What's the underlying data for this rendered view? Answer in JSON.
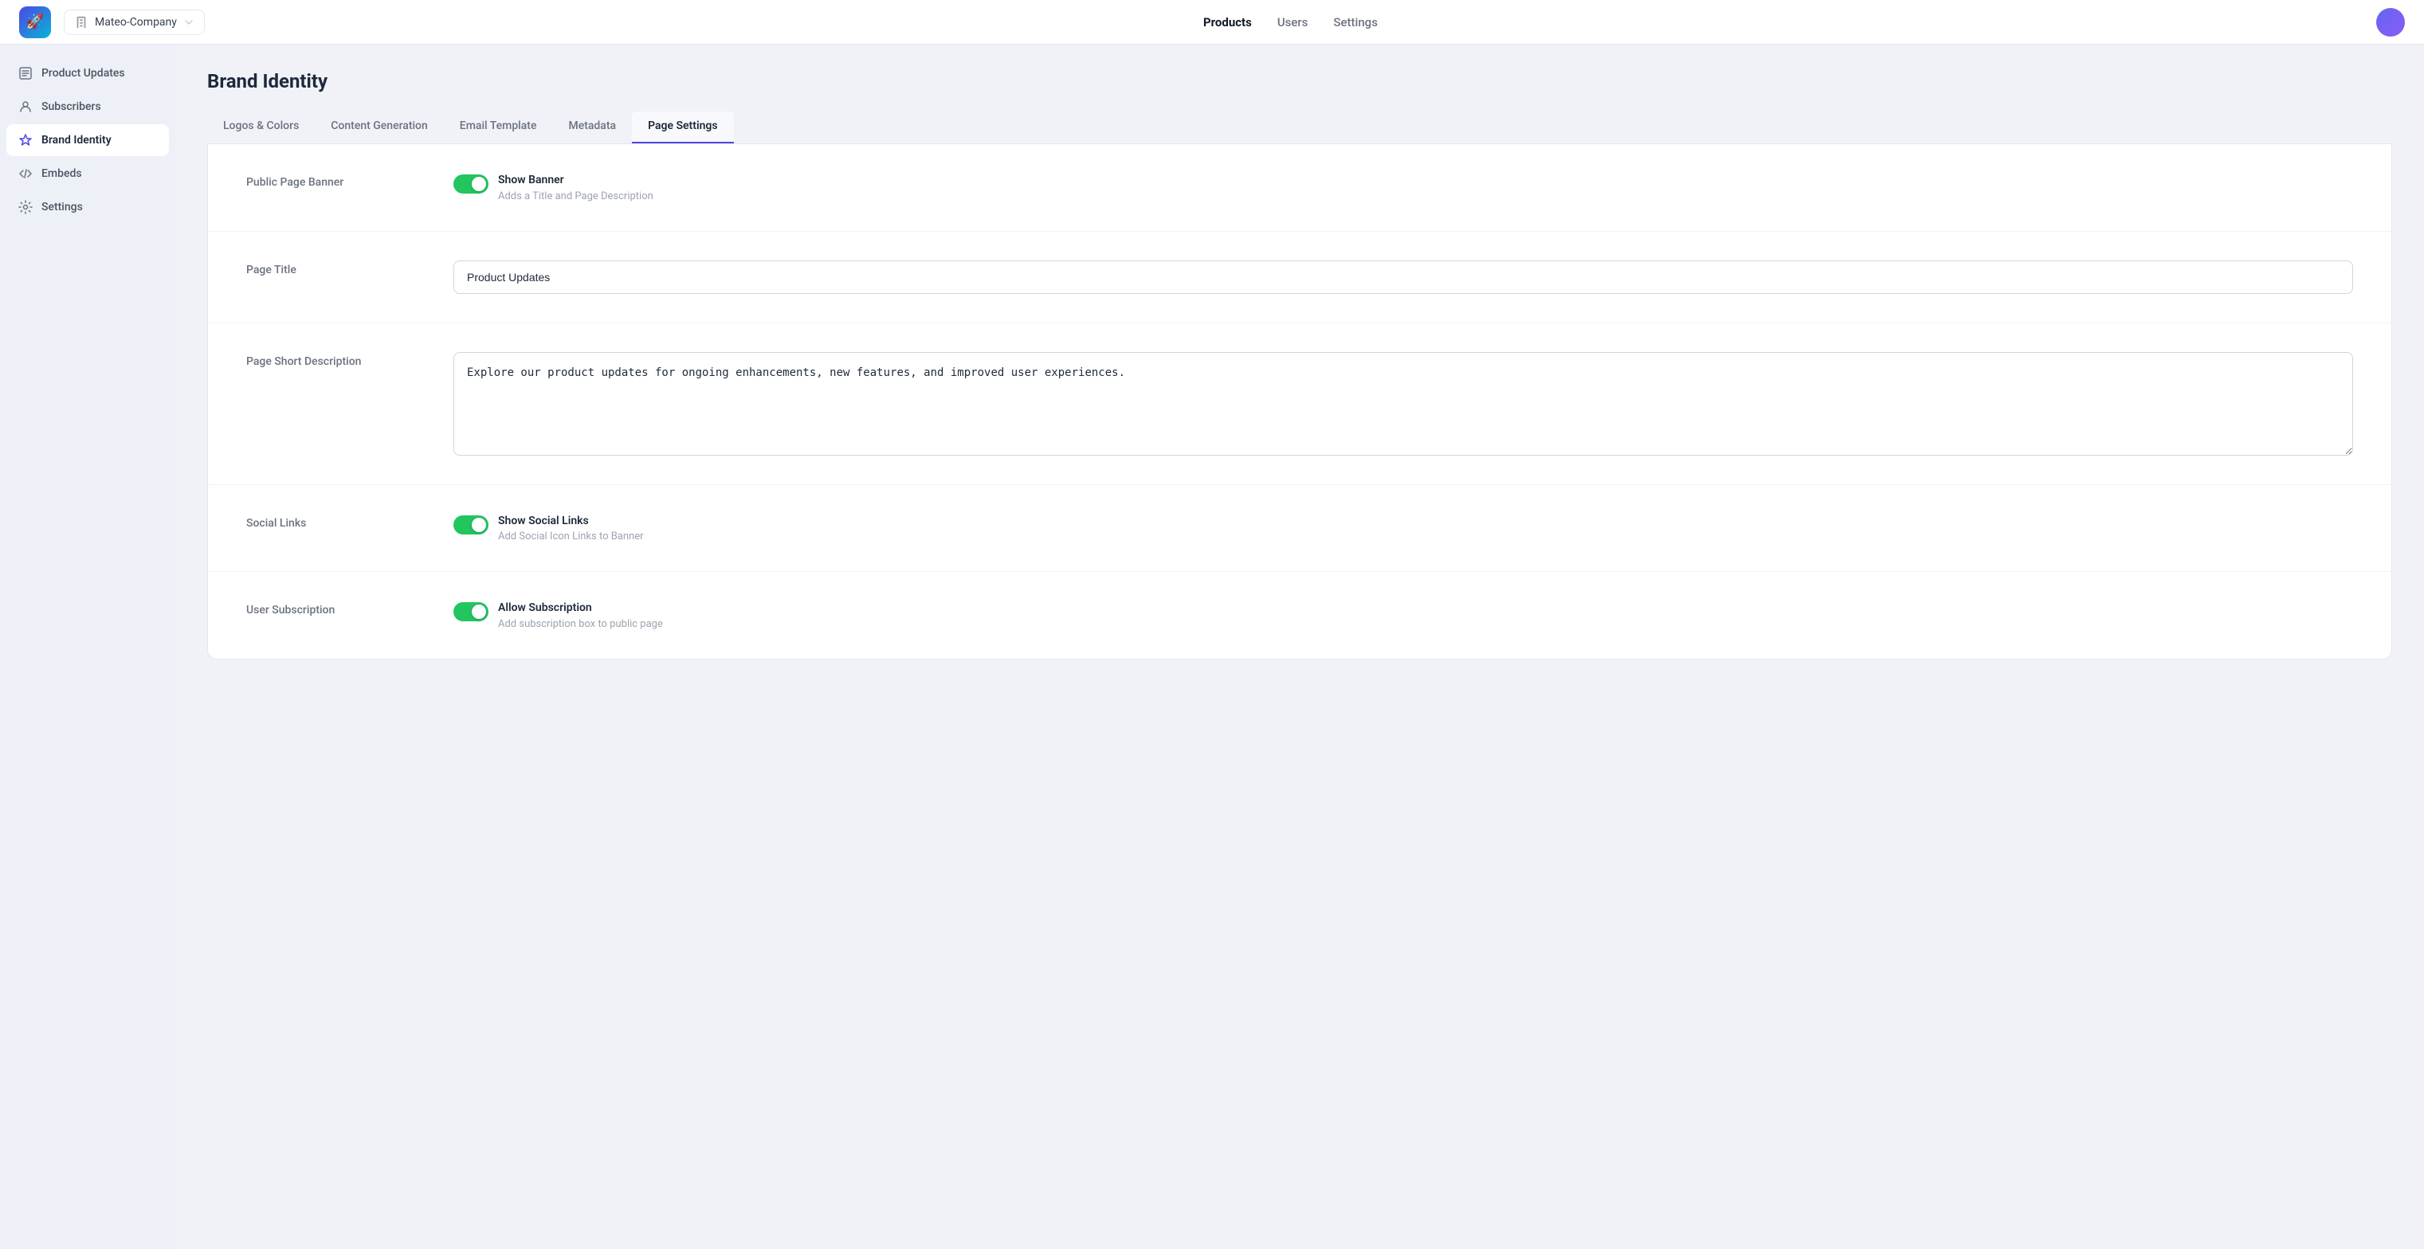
{
  "topnav": {
    "logo_icon": "🚀",
    "company_name": "Mateo-Company",
    "company_icon": "▼",
    "nav_links": [
      {
        "id": "products",
        "label": "Products",
        "active": true
      },
      {
        "id": "users",
        "label": "Users",
        "active": false
      },
      {
        "id": "settings",
        "label": "Settings",
        "active": false
      }
    ]
  },
  "sidebar": {
    "items": [
      {
        "id": "product-updates",
        "label": "Product Updates",
        "icon": "□",
        "active": false
      },
      {
        "id": "subscribers",
        "label": "Subscribers",
        "icon": "👤",
        "active": false
      },
      {
        "id": "brand-identity",
        "label": "Brand Identity",
        "icon": "◇",
        "active": true
      },
      {
        "id": "embeds",
        "label": "Embeds",
        "icon": "</>",
        "active": false
      },
      {
        "id": "settings",
        "label": "Settings",
        "icon": "⚙",
        "active": false
      }
    ]
  },
  "page": {
    "title": "Brand Identity",
    "tabs": [
      {
        "id": "logos-colors",
        "label": "Logos & Colors",
        "active": false
      },
      {
        "id": "content-generation",
        "label": "Content Generation",
        "active": false
      },
      {
        "id": "email-template",
        "label": "Email Template",
        "active": false
      },
      {
        "id": "metadata",
        "label": "Metadata",
        "active": false
      },
      {
        "id": "page-settings",
        "label": "Page Settings",
        "active": true
      }
    ]
  },
  "sections": {
    "public_page_banner": {
      "label": "Public Page Banner",
      "toggle_label": "Show Banner",
      "toggle_desc": "Adds a Title and Page Description",
      "enabled": true
    },
    "page_title": {
      "label": "Page Title",
      "value": "Product Updates"
    },
    "page_short_description": {
      "label": "Page Short Description",
      "value": "Explore our product updates for ongoing enhancements, new features, and improved user experiences."
    },
    "social_links": {
      "label": "Social Links",
      "toggle_label": "Show Social Links",
      "toggle_desc": "Add Social Icon Links to Banner",
      "enabled": true
    },
    "user_subscription": {
      "label": "User Subscription",
      "toggle_label": "Allow Subscription",
      "toggle_desc": "Add subscription box to public page",
      "enabled": true
    }
  }
}
